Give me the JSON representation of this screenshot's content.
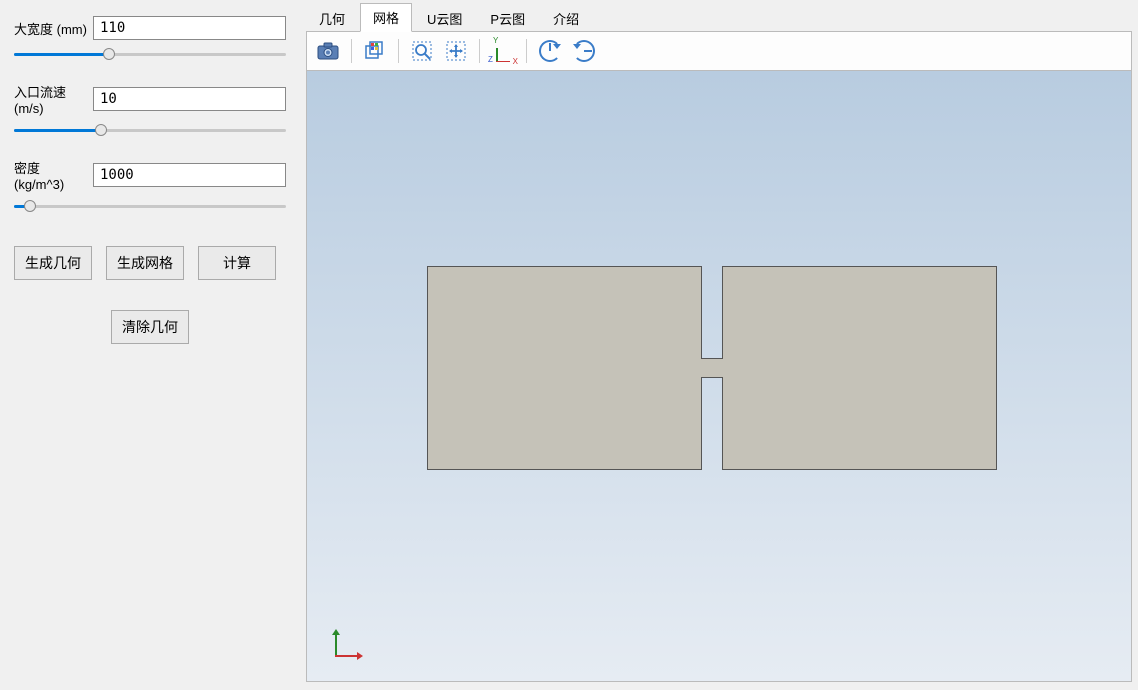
{
  "params": {
    "width": {
      "label": "大宽度 (mm)",
      "value": "110",
      "slider_pct": 35
    },
    "velocity": {
      "label": "入口流速 (m/s)",
      "value": "10",
      "slider_pct": 32
    },
    "density": {
      "label": "密度 (kg/m^3)",
      "value": "1000",
      "slider_pct": 6
    }
  },
  "buttons": {
    "generate_geom": "生成几何",
    "generate_mesh": "生成网格",
    "calculate": "计算",
    "clear_geom": "清除几何"
  },
  "tabs": [
    {
      "label": "几何",
      "active": false
    },
    {
      "label": "网格",
      "active": true
    },
    {
      "label": "U云图",
      "active": false
    },
    {
      "label": "P云图",
      "active": false
    },
    {
      "label": "介绍",
      "active": false
    }
  ],
  "toolbar_icons": {
    "camera": "camera-icon",
    "layers": "layers-icon",
    "zoom": "zoom-icon",
    "pan": "pan-icon",
    "axes": "axes-icon",
    "rotate_right": "rotate-right-icon",
    "rotate_ccw": "rotate-ccw-icon"
  }
}
